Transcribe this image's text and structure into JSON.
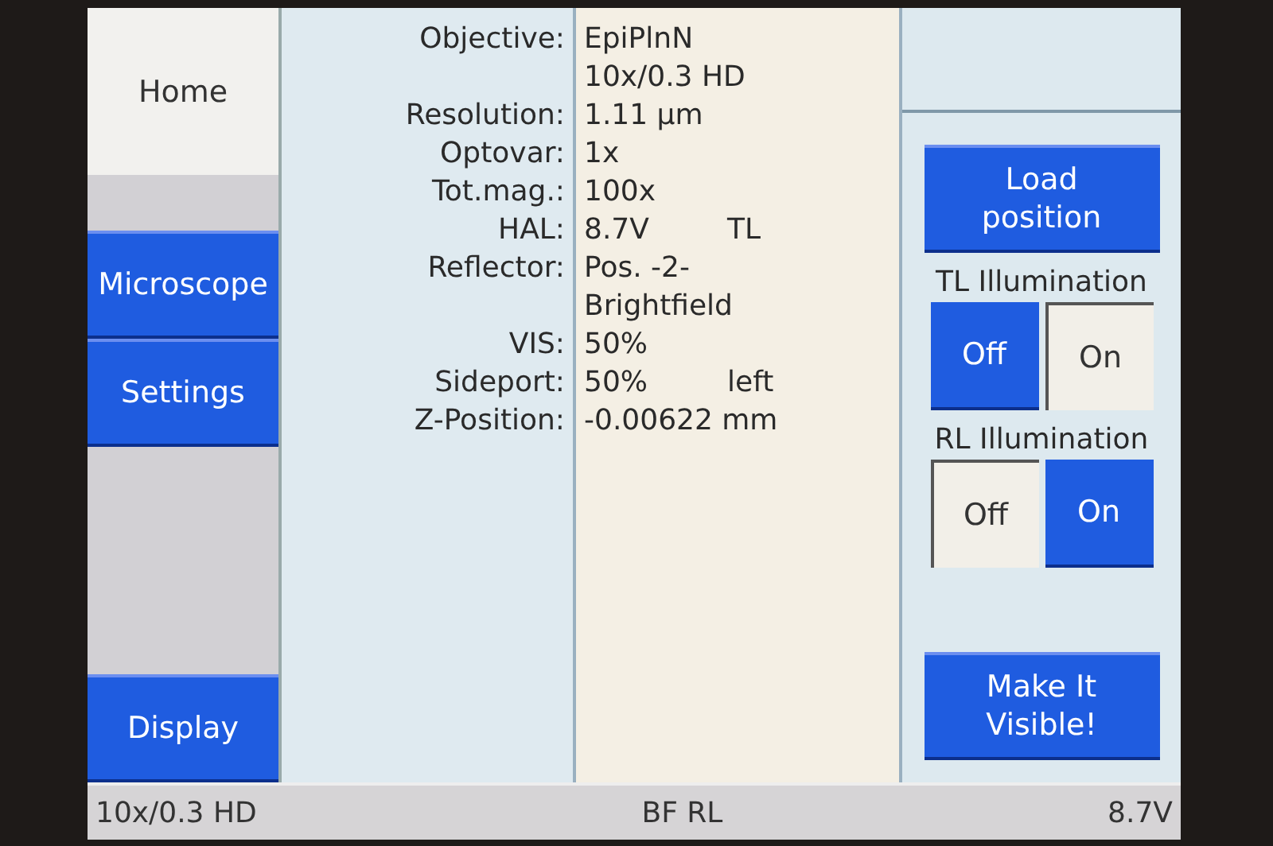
{
  "nav": [
    {
      "label": "Home",
      "selected": true
    },
    {
      "label": "Microscope",
      "selected": false
    },
    {
      "label": "Settings",
      "selected": false
    },
    {
      "label": "Display",
      "selected": false
    }
  ],
  "properties": [
    {
      "label": "Objective:",
      "value": [
        "EpiPlnN",
        "10x/0.3 HD"
      ]
    },
    {
      "label": "Resolution:",
      "value": [
        "1.11 µm"
      ]
    },
    {
      "label": "Optovar:",
      "value": [
        "1x"
      ]
    },
    {
      "label": "Tot.mag.:",
      "value": [
        "100x"
      ]
    },
    {
      "label": "HAL:",
      "value": [
        "8.7V"
      ],
      "extra": "TL"
    },
    {
      "label": "Reflector:",
      "value": [
        "Pos. -2-",
        "Brightfield"
      ]
    },
    {
      "label": "VIS:",
      "value": [
        "50%"
      ]
    },
    {
      "label": "Sideport:",
      "value": [
        "50%"
      ],
      "extra": "left"
    },
    {
      "label": "Z-Position:",
      "value": [
        "-0.00622 mm"
      ]
    }
  ],
  "load_button": "Load\nposition",
  "illumination": [
    {
      "title": "TL Illumination",
      "options": [
        {
          "label": "Off",
          "selected": true
        },
        {
          "label": "On",
          "selected": false
        }
      ]
    },
    {
      "title": "RL Illumination",
      "options": [
        {
          "label": "Off",
          "selected": false
        },
        {
          "label": "On",
          "selected": true
        }
      ]
    }
  ],
  "visible_button": "Make It\nVisible!",
  "status_bar": {
    "objective": "10x/0.3 HD",
    "mode": "BF RL",
    "voltage": "8.7V"
  }
}
